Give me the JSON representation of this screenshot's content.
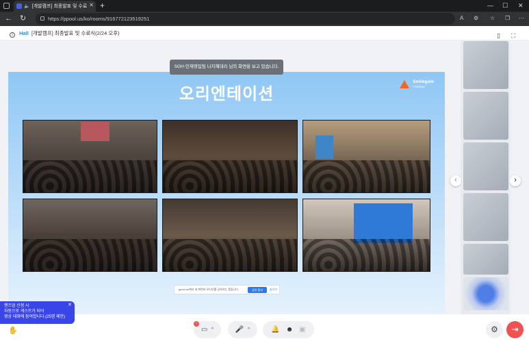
{
  "browser": {
    "tab_title": "[개발캠프] 최종발표 및 수료",
    "url": "https://ppool.us/ko/rooms/916772123519251",
    "reading_glyph": "A",
    "new_tab": "+"
  },
  "info": {
    "hall_label": "Hall",
    "room_title": "[개발캠프] 최종발표 및 수료식(2/24 오후)"
  },
  "toast": "SGH-인재영입팀 나지혜대리 님의 화면을 보고 있습니다.",
  "slide": {
    "title": "오리엔테이션",
    "brand_name": "Smilegate",
    "brand_sub": "Holdings"
  },
  "share_bar": {
    "text": "ppool.us에서 내 화면과 오디오를 공유하는 중입니다.",
    "share_button": "공유 중지",
    "hide_button": "숨기기"
  },
  "tip": {
    "line1": "핸즈업 신청 시",
    "line2": "자동으로 게스트가 되어",
    "line3": "영상 대화에 참여합니다.(25명 제한)"
  },
  "colors": {
    "accent": "#3a45e8",
    "leave": "#f05252",
    "share": "#2b7de2"
  },
  "icons": [
    "back-arrow-icon",
    "refresh-icon",
    "lock-icon",
    "camera-off-icon",
    "mic-off-icon",
    "emoji-icon",
    "settings-icon",
    "leave-icon",
    "hand-raise-icon"
  ]
}
